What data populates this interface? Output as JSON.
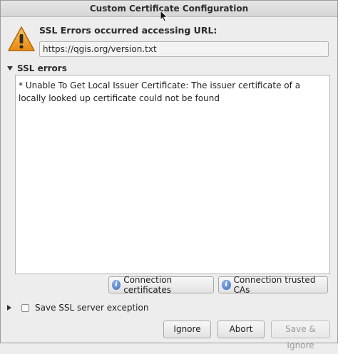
{
  "window": {
    "title": "Custom Certificate Configuration"
  },
  "message": {
    "heading": "SSL Errors occurred accessing URL:",
    "url": "https://qgis.org/version.txt"
  },
  "ssl_errors": {
    "label": "SSL errors",
    "text": "* Unable To Get Local Issuer Certificate: The issuer certificate of a locally looked up certificate could not be found"
  },
  "cert_buttons": {
    "connection_certificates": "Connection certificates",
    "connection_trusted_cas": "Connection trusted CAs"
  },
  "save_exception": {
    "label": "Save SSL server exception",
    "checked": false
  },
  "dialog_buttons": {
    "ignore": "Ignore",
    "abort": "Abort",
    "save_ignore": "Save & Ignore"
  },
  "icons": [
    "warning-icon",
    "info-icon",
    "expand-arrow-icon",
    "collapse-arrow-icon",
    "mouse-cursor-icon"
  ],
  "colors": {
    "warning": "#f0a024",
    "info": "#3f6cbf"
  }
}
